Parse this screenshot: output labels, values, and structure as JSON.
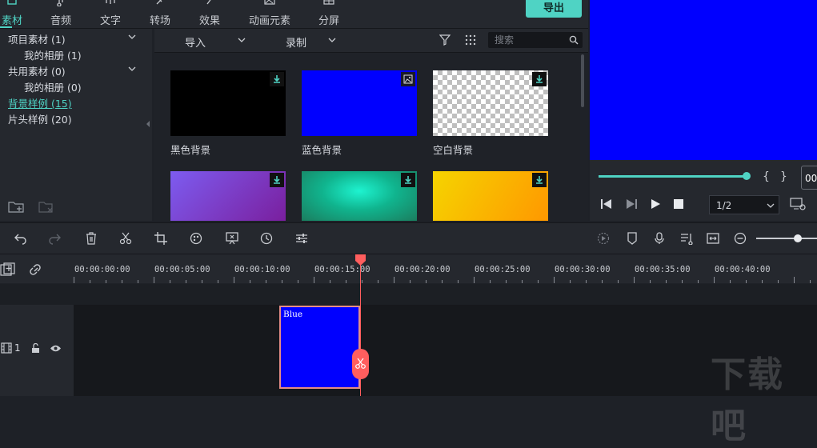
{
  "tabs": [
    {
      "label": "素材",
      "icon": "media-icon",
      "active": true
    },
    {
      "label": "音频",
      "icon": "music-note-icon"
    },
    {
      "label": "文字",
      "icon": "text-icon"
    },
    {
      "label": "转场",
      "icon": "transition-icon"
    },
    {
      "label": "效果",
      "icon": "effects-icon"
    },
    {
      "label": "动画元素",
      "icon": "image-icon"
    },
    {
      "label": "分屏",
      "icon": "split-screen-icon"
    }
  ],
  "export_label": "导出",
  "library": {
    "items": [
      {
        "label": "项目素材 (1)",
        "expandable": true
      },
      {
        "label": "我的相册 (1)"
      },
      {
        "label": "共用素材 (0)",
        "expandable": true
      },
      {
        "label": "我的相册 (0)"
      },
      {
        "label": "背景样例 (15)",
        "selected": true
      },
      {
        "label": "片头样例 (20)"
      }
    ]
  },
  "media_toolbar": {
    "import_label": "导入",
    "record_label": "录制",
    "search_placeholder": "搜索"
  },
  "thumbnails": [
    {
      "label": "黑色背景",
      "badge": "download-icon",
      "color": "#000000"
    },
    {
      "label": "蓝色背景",
      "badge": "image-icon",
      "color": "#0000ff"
    },
    {
      "label": "空白背景",
      "badge": "download-icon",
      "color": "checkerboard"
    },
    {
      "label": "",
      "badge": "download-icon",
      "color": "#8a3fc9"
    },
    {
      "label": "",
      "badge": "download-icon",
      "color": "#15c9a2"
    },
    {
      "label": "",
      "badge": "download-icon",
      "color": "#f5c400"
    }
  ],
  "preview": {
    "ratio": "1/2",
    "timecode_partial": "00",
    "progress": 1.0,
    "accent": "#4fd3c4"
  },
  "timeline": {
    "ticks": [
      "00:00:00:00",
      "00:00:05:00",
      "00:00:10:00",
      "00:00:15:00",
      "00:00:20:00",
      "00:00:25:00",
      "00:00:30:00",
      "00:00:35:00",
      "00:00:40:00"
    ],
    "track_label": "1",
    "clip_label": "Blue",
    "playhead_color": "#ff5e5e"
  },
  "watermark": "下载吧"
}
